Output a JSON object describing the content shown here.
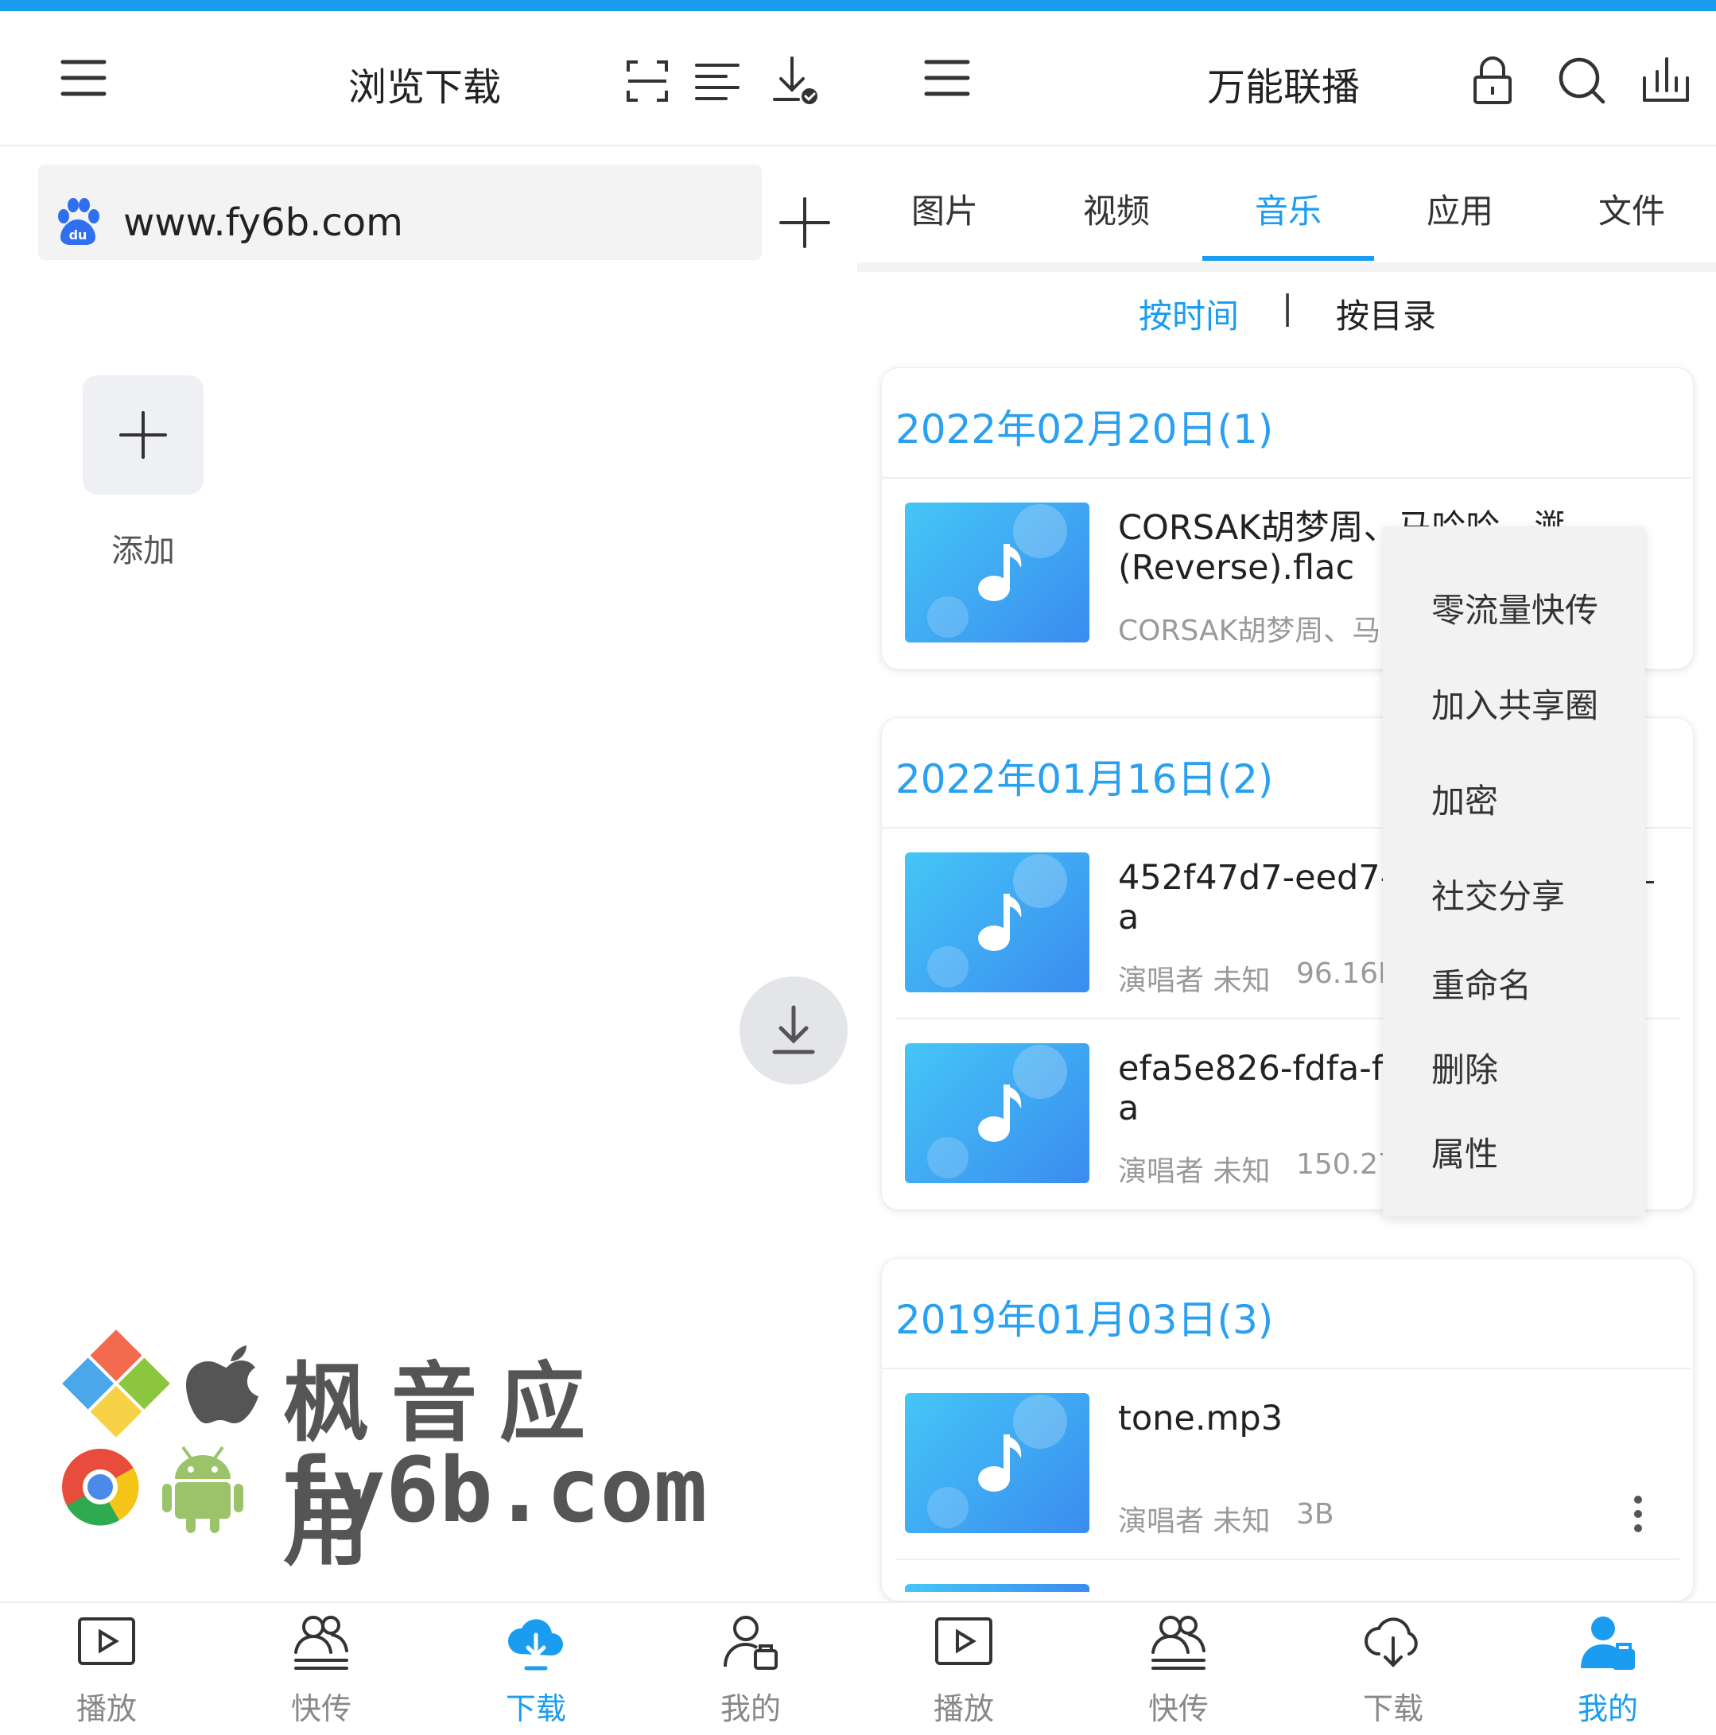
{
  "left_pane": {
    "title": "浏览下载",
    "url": "www.fy6b.com",
    "add_label": "添加",
    "watermark_cn": "枫音应用",
    "watermark_url": "fy6b.com"
  },
  "right_pane": {
    "title": "万能联播",
    "tabs": [
      {
        "label": "图片"
      },
      {
        "label": "视频"
      },
      {
        "label": "音乐"
      },
      {
        "label": "应用"
      },
      {
        "label": "文件"
      }
    ],
    "active_tab": "音乐",
    "sort": {
      "by_time": "按时间",
      "by_dir": "按目录",
      "separator": "|"
    },
    "groups": [
      {
        "date": "2022年02月20日(1)",
        "items": [
          {
            "name_line1": "CORSAK胡梦周、马吟吟 - 溯",
            "name_line2": "(Reverse).flac",
            "meta_artist": "CORSAK胡梦周、马",
            "meta_size": ""
          }
        ]
      },
      {
        "date": "2022年01月16日(2)",
        "items": [
          {
            "name_line1": "452f47d7-eed7-",
            "name_line2": "a",
            "meta_artist": "演唱者 未知",
            "meta_size": "96.16K"
          },
          {
            "name_line1": "efa5e826-fdfa-f",
            "name_line2": "a",
            "meta_artist": "演唱者 未知",
            "meta_size": "150.27"
          }
        ]
      },
      {
        "date": "2019年01月03日(3)",
        "items": [
          {
            "name_line1": "tone.mp3",
            "name_line2": "",
            "meta_artist": "演唱者 未知",
            "meta_size": "3B"
          }
        ]
      }
    ],
    "context_menu": [
      "零流量快传",
      "加入共享圈",
      "加密",
      "社交分享",
      "重命名",
      "删除",
      "属性"
    ]
  },
  "bottom_nav": [
    {
      "label": "播放",
      "icon": "play-icon",
      "active": false
    },
    {
      "label": "快传",
      "icon": "users-icon",
      "active": false
    },
    {
      "label": "下载",
      "icon": "cloud-download-icon",
      "active": true
    },
    {
      "label": "我的",
      "icon": "user-share-icon",
      "active": false
    },
    {
      "label": "播放",
      "icon": "play-icon",
      "active": false
    },
    {
      "label": "快传",
      "icon": "users-icon",
      "active": false
    },
    {
      "label": "下载",
      "icon": "cloud-download-icon",
      "active": false
    },
    {
      "label": "我的",
      "icon": "user-share-icon",
      "active": true
    }
  ],
  "colors": {
    "accent": "#1a9df0",
    "date_text": "#2aa0f0",
    "thumb_start": "#45c6f7",
    "thumb_end": "#3a8cef"
  }
}
